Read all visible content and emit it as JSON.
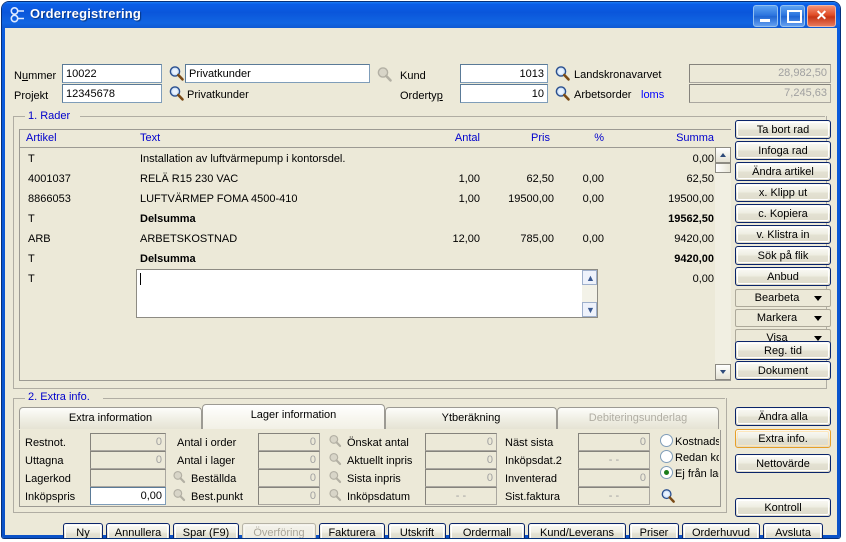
{
  "window": {
    "title": "Orderregistrering",
    "icon": "order-icon",
    "controls": {
      "minimize": "minimize-button",
      "maximize": "maximize-button",
      "close": "close-button"
    }
  },
  "header": {
    "nummer_label": "Nummer",
    "nummer_value": "10022",
    "nummer_name": "Privatkunder",
    "projekt_label": "Projekt",
    "projekt_value": "12345678",
    "projekt_name": "Privatkunder",
    "kund_label": "Kund",
    "kund_value": "1013",
    "kund_name": "Landskronavarvet",
    "ordertyp_label": "Ordertyp",
    "ordertyp_value": "10",
    "ordertyp_name": "Arbetsorder",
    "ordertyp_extra": "loms",
    "total_1": "28,982,50",
    "total_2": "7,245,63"
  },
  "rader": {
    "caption": "1. Rader",
    "columns": [
      "Artikel",
      "Text",
      "Antal",
      "Pris",
      "%",
      "Summa"
    ],
    "rows": [
      {
        "artikel": "T",
        "text": "Installation av luftvärmepump i kontorsdel.",
        "antal": "",
        "pris": "",
        "pct": "",
        "summa": "0,00",
        "bold": false
      },
      {
        "artikel": "4001037",
        "text": "RELÄ R15 230 VAC",
        "antal": "1,00",
        "pris": "62,50",
        "pct": "0,00",
        "summa": "62,50",
        "bold": false
      },
      {
        "artikel": "8866053",
        "text": "LUFTVÄRMEP FOMA 4500-410",
        "antal": "1,00",
        "pris": "19500,00",
        "pct": "0,00",
        "summa": "19500,00",
        "bold": false
      },
      {
        "artikel": "T",
        "text": "Delsumma",
        "antal": "",
        "pris": "",
        "pct": "",
        "summa": "19562,50",
        "bold": true
      },
      {
        "artikel": "ARB",
        "text": "ARBETSKOSTNAD",
        "antal": "12,00",
        "pris": "785,00",
        "pct": "0,00",
        "summa": "9420,00",
        "bold": false
      },
      {
        "artikel": "T",
        "text": "Delsumma",
        "antal": "",
        "pris": "",
        "pct": "",
        "summa": "9420,00",
        "bold": true
      },
      {
        "artikel": "T",
        "text": "",
        "antal": "",
        "pris": "",
        "pct": "",
        "summa": "0,00",
        "bold": false
      }
    ],
    "editor_value": ""
  },
  "side_buttons": [
    {
      "label": "Ta bort rad",
      "style": "normal"
    },
    {
      "label": "Infoga rad",
      "style": "normal"
    },
    {
      "label": "Ändra artikel",
      "style": "normal"
    },
    {
      "label": "x. Klipp ut",
      "style": "normal"
    },
    {
      "label": "c. Kopiera",
      "style": "normal"
    },
    {
      "label": "v. Klistra in",
      "style": "normal"
    },
    {
      "label": "Sök på flik",
      "style": "normal"
    },
    {
      "label": "Anbud",
      "style": "normal"
    },
    {
      "label": "Bearbeta",
      "style": "flat-menu"
    },
    {
      "label": "Markera",
      "style": "flat-menu"
    },
    {
      "label": "Visa",
      "style": "flat-menu"
    },
    {
      "label": "Reg. tid",
      "style": "normal"
    },
    {
      "label": "Dokument",
      "style": "normal"
    }
  ],
  "side_buttons_lower": [
    {
      "label": "Ändra alla",
      "style": "normal"
    },
    {
      "label": "Extra info.",
      "style": "focus"
    },
    {
      "label": "Nettovärde",
      "style": "normal"
    },
    {
      "label": "Kontroll",
      "style": "normal"
    }
  ],
  "extra": {
    "caption": "2. Extra info.",
    "tabs": [
      {
        "label": "Extra information",
        "selected": false,
        "disabled": false
      },
      {
        "label": "Lager information",
        "selected": true,
        "disabled": false
      },
      {
        "label": "Ytberäkning",
        "selected": false,
        "disabled": false
      },
      {
        "label": "Debiteringsunderlag",
        "selected": false,
        "disabled": true
      }
    ],
    "col1": [
      {
        "label": "Restnot.",
        "value": "0",
        "readonly": true
      },
      {
        "label": "Uttagna",
        "value": "0",
        "readonly": true
      },
      {
        "label": "Lagerkod",
        "value": "",
        "readonly": true
      },
      {
        "label": "Inköpspris",
        "value": "0,00",
        "readonly": false
      }
    ],
    "col2": [
      {
        "label": "Antal i order",
        "value": "0",
        "mag": false
      },
      {
        "label": "Antal i lager",
        "value": "0",
        "mag": false
      },
      {
        "label": "Beställda",
        "value": "0",
        "mag": true
      },
      {
        "label": "Best.punkt",
        "value": "0",
        "mag": true
      }
    ],
    "col3": [
      {
        "label": "Önskat  antal",
        "value": "0",
        "mag": true
      },
      {
        "label": "Aktuellt inpris",
        "value": "0",
        "mag": true
      },
      {
        "label": "Sista inpris",
        "value": "0",
        "mag": true
      },
      {
        "label": "Inköpsdatum",
        "value": "-  -",
        "mag": true
      }
    ],
    "col4": [
      {
        "label": "Näst sista",
        "value": "0"
      },
      {
        "label": "Inköpsdat.2",
        "value": "-  -"
      },
      {
        "label": "Inventerad",
        "value": "0"
      },
      {
        "label": "Sist.faktura",
        "value": "-  -"
      }
    ],
    "radios": [
      {
        "label": "Kostnadsfö",
        "checked": false
      },
      {
        "label": "Redan kost",
        "checked": false
      },
      {
        "label": "Ej från lage",
        "checked": true
      }
    ]
  },
  "bottom_buttons": [
    {
      "label": "Ny",
      "disabled": false
    },
    {
      "label": "Annullera",
      "disabled": false
    },
    {
      "label": "Spar (F9)",
      "disabled": false
    },
    {
      "label": "Överföring",
      "disabled": true
    },
    {
      "label": "Fakturera",
      "disabled": false
    },
    {
      "label": "Utskrift",
      "disabled": false
    },
    {
      "label": "Ordermall",
      "disabled": false
    },
    {
      "label": "Kund/Leverans",
      "disabled": false
    },
    {
      "label": "Priser",
      "disabled": false
    },
    {
      "label": "Orderhuvud",
      "disabled": false
    },
    {
      "label": "Avsluta",
      "disabled": false
    }
  ],
  "colors": {
    "face": "#ece9d8",
    "titlebar": "#0a56db",
    "accent_blue": "#0000cc",
    "link": "#0000ff",
    "disabled_text": "#a0a0a0",
    "focus_border": "#e79f28"
  }
}
